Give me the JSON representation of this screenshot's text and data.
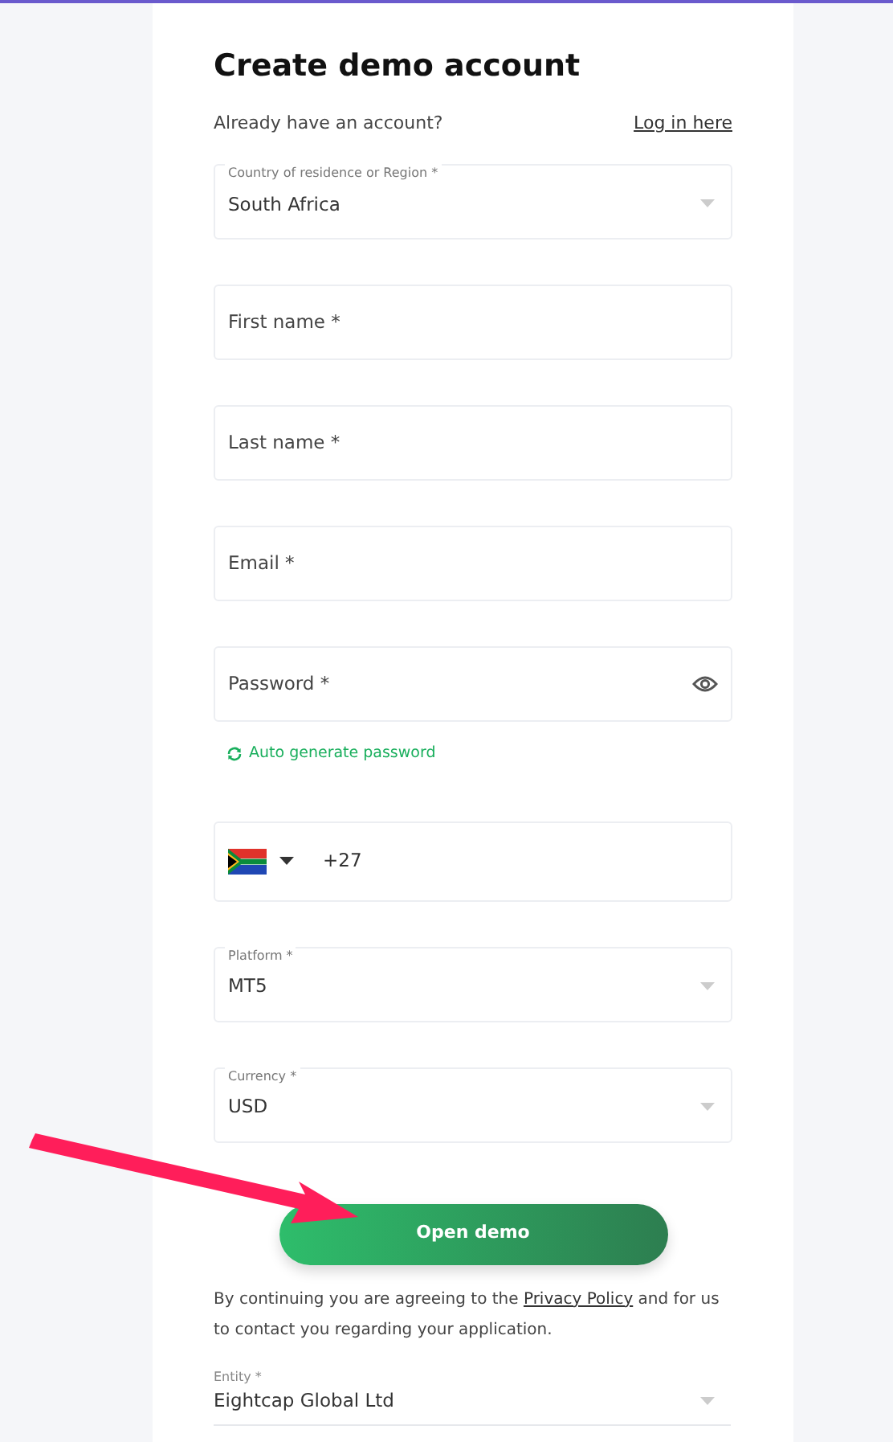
{
  "title": "Create demo account",
  "login_prompt": {
    "text": "Already have an account?",
    "link": "Log in here"
  },
  "fields": [
    {
      "kind": "select",
      "label": "Country of residence or Region *",
      "value": "South Africa"
    },
    {
      "kind": "input",
      "placeholder": "First name *"
    },
    {
      "kind": "input",
      "placeholder": "Last name *"
    },
    {
      "kind": "input",
      "placeholder": "Email *"
    },
    {
      "kind": "password",
      "placeholder": "Password *",
      "helper": "Auto generate password"
    },
    {
      "kind": "phone",
      "value": "+27"
    },
    {
      "kind": "select",
      "label": "Platform *",
      "value": "MT5"
    },
    {
      "kind": "select",
      "label": "Currency *",
      "value": "USD"
    }
  ],
  "submit_button": "Open demo",
  "consent": {
    "before": "By continuing you are agreeing to the ",
    "link": "Privacy Policy",
    "after": " and for us to contact you regarding your application."
  },
  "entity": {
    "label": "Entity *",
    "value": "Eightcap Global Ltd"
  }
}
